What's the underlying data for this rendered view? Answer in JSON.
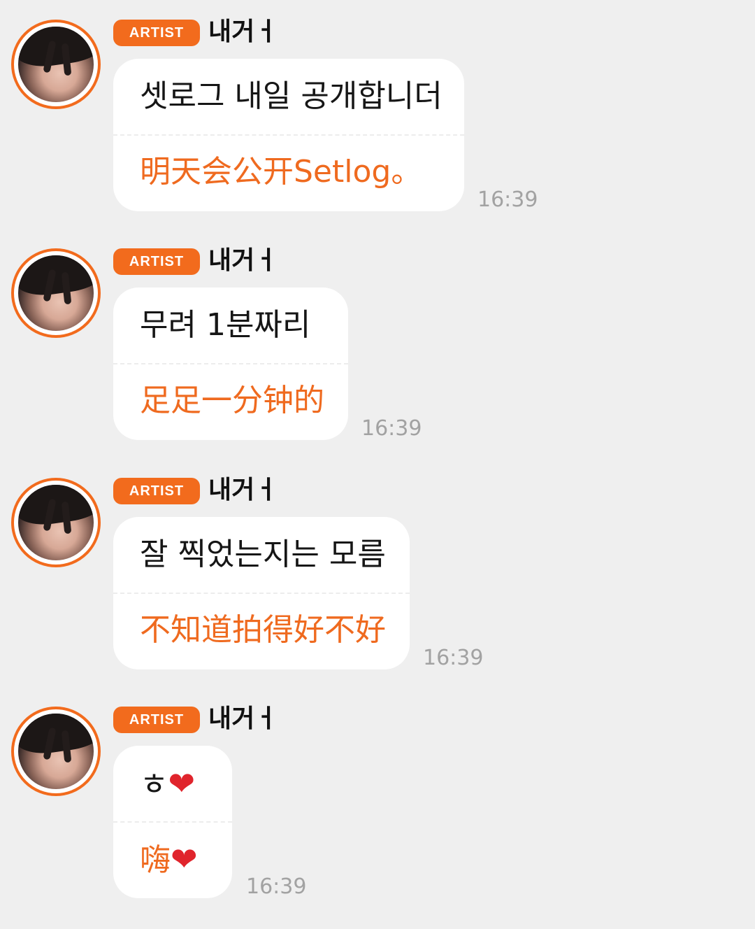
{
  "badge_label": "ARTIST",
  "messages": [
    {
      "sender": "내거ㅓ",
      "korean": "셋로그 내일 공개합니더",
      "chinese": "明天会公开Setlog。",
      "time": "16:39"
    },
    {
      "sender": "내거ㅓ",
      "korean": "무려 1분짜리",
      "chinese": "足足一分钟的",
      "time": "16:39"
    },
    {
      "sender": "내거ㅓ",
      "korean": "잘 찍었는지는 모름",
      "chinese": "不知道拍得好不好",
      "time": "16:39"
    },
    {
      "sender": "내거ㅓ",
      "korean": "ㅎ",
      "korean_emoji": "❤",
      "chinese": "嗨",
      "chinese_emoji": "❤",
      "time": "16:39"
    }
  ],
  "colors": {
    "accent": "#f26b1d",
    "background": "#efefef",
    "bubble": "#ffffff",
    "translation_text": "#ef6a1f",
    "timestamp": "#a2a2a2"
  },
  "icons": {
    "avatar": "profile-photo",
    "heart": "red-heart-emoji"
  }
}
